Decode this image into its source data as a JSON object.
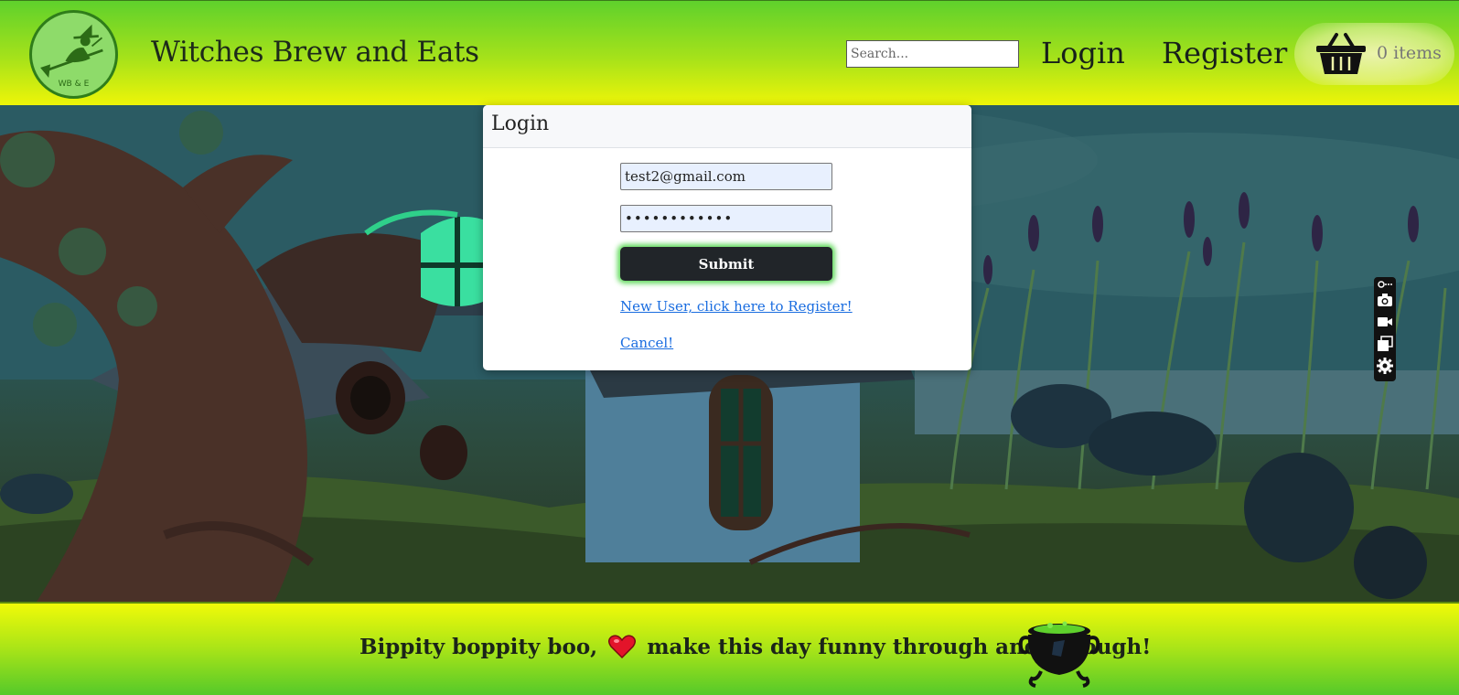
{
  "header": {
    "logo_text": "WB & E",
    "brand": "Witches Brew and Eats",
    "search_placeholder": "Search...",
    "nav": {
      "login": "Login",
      "register": "Register"
    },
    "cart": {
      "icon": "basket-icon",
      "count_label": "0 items"
    }
  },
  "modal": {
    "title": "Login",
    "email_value": "test2@gmail.com",
    "password_value": "••••••••••••",
    "submit_label": "Submit",
    "register_link": "New User, click here to Register!",
    "cancel_link": "Cancel!"
  },
  "toolbar": {
    "icons": [
      "link-icon",
      "camera-icon",
      "video-icon",
      "layers-icon",
      "gear-icon"
    ]
  },
  "footer": {
    "text_before": "Bippity boppity boo,",
    "text_after": "make this day funny through and through!",
    "heart_icon": "heart-icon",
    "cauldron_icon": "cauldron-icon"
  },
  "colors": {
    "header_green": "#5fd12c",
    "header_yellow": "#eef508",
    "submit_bg": "#212529",
    "submit_glow": "#5fd95a",
    "link": "#1a6de0"
  }
}
